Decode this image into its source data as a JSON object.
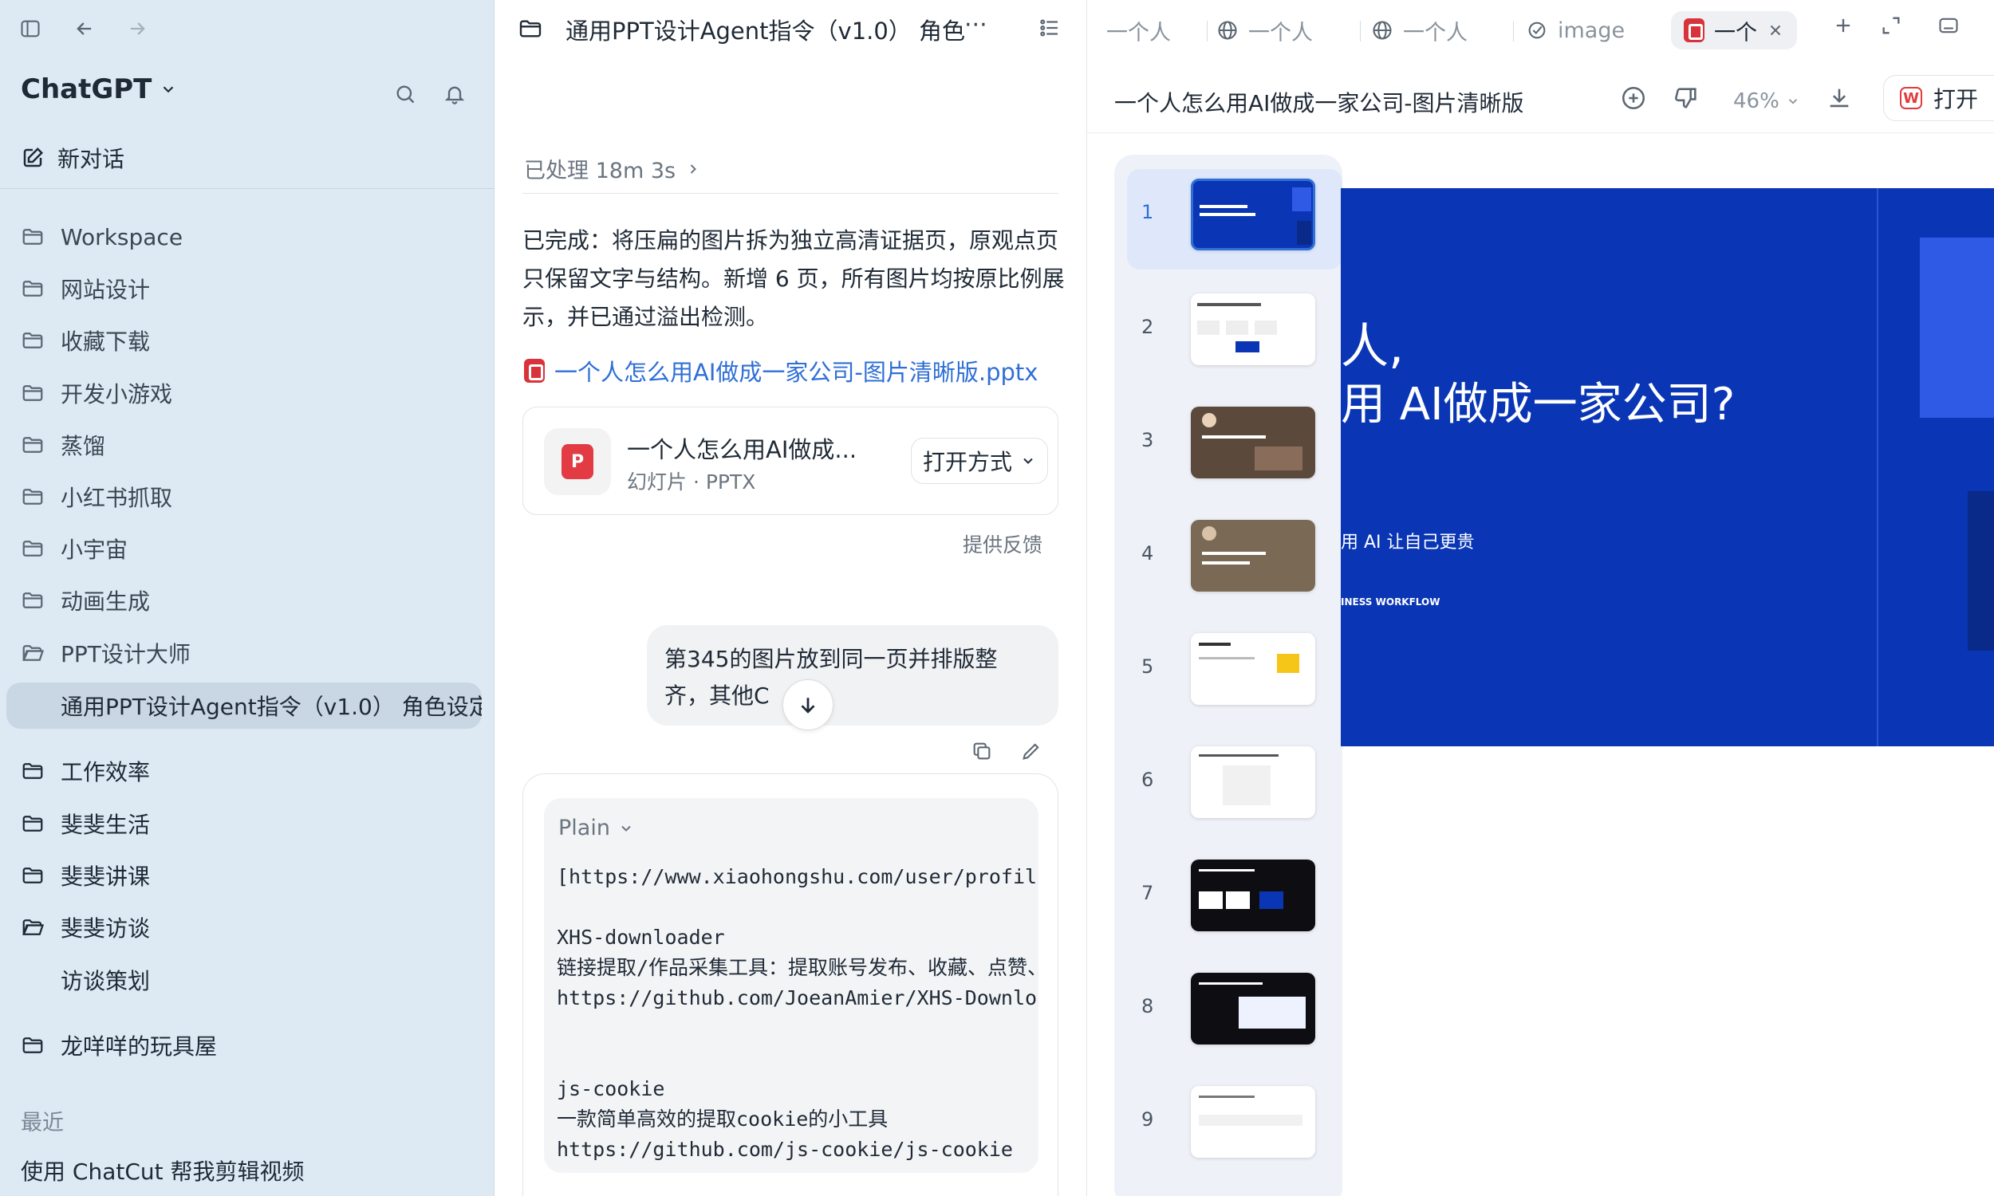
{
  "sidebar": {
    "brand": "ChatGPT",
    "new_chat": "新对话",
    "projects": [
      "Workspace",
      "网站设计",
      "收藏下载",
      "开发小游戏",
      "蒸馏",
      "小红书抓取",
      "小宇宙",
      "动画生成",
      "PPT设计大师",
      "通用PPT设计Agent指令（v1.0） 角色设定",
      "工作效率",
      "斐斐生活",
      "斐斐讲课",
      "斐斐访谈",
      "访谈策划",
      "龙咩咩的玩具屋"
    ],
    "section_recent": "最近",
    "recent_item": "使用 ChatCut 帮我剪辑视频"
  },
  "chat": {
    "title": "通用PPT设计Agent指令（v1.0） 角色",
    "more": "···",
    "processed": "已处理 18m 3s",
    "paragraph": "已完成：将压扁的图片拆为独立高清证据页，原观点页只保留文字与结构。新增 6 页，所有图片均按原比例展示，并已通过溢出检测。",
    "file_link": "一个人怎么用AI做成一家公司-图片清晰版.pptx",
    "file_card": {
      "name": "一个人怎么用AI做成...",
      "type": "幻灯片 · PPTX",
      "open_with": "打开方式"
    },
    "feedback": "提供反馈",
    "user_message": "第345的图片放到同一页并排版整齐，其他C",
    "code": {
      "lang": "Plain",
      "lines": [
        "[https://www.xiaohongshu.com/user/profil",
        "",
        "XHS-downloader",
        "链接提取/作品采集工具：提取账号发布、收藏、点赞、",
        "https://github.com/JoeanAmier/XHS-Downlo",
        "",
        "",
        "js-cookie",
        "一款简单高效的提取cookie的小工具",
        "https://github.com/js-cookie/js-cookie"
      ]
    }
  },
  "viewer": {
    "tabs": [
      "一个人",
      "一个人",
      "一个人",
      "image",
      "一个"
    ],
    "doc_title": "一个人怎么用AI做成一家公司-图片清晰版",
    "zoom": "46%",
    "open": "打开",
    "slide_numbers": [
      "1",
      "2",
      "3",
      "4",
      "5",
      "6",
      "7",
      "8",
      "9"
    ],
    "slide": {
      "line1": "人,",
      "line2": "用 AI做成一家公司?",
      "sub": "用 AI 让自己更贵",
      "tags": "INESS   WORKFLOW"
    }
  },
  "colors": {
    "sidebar_bg": "#dde9f3",
    "accent": "#2f6fd6",
    "slide_bg": "#0a36b6"
  }
}
